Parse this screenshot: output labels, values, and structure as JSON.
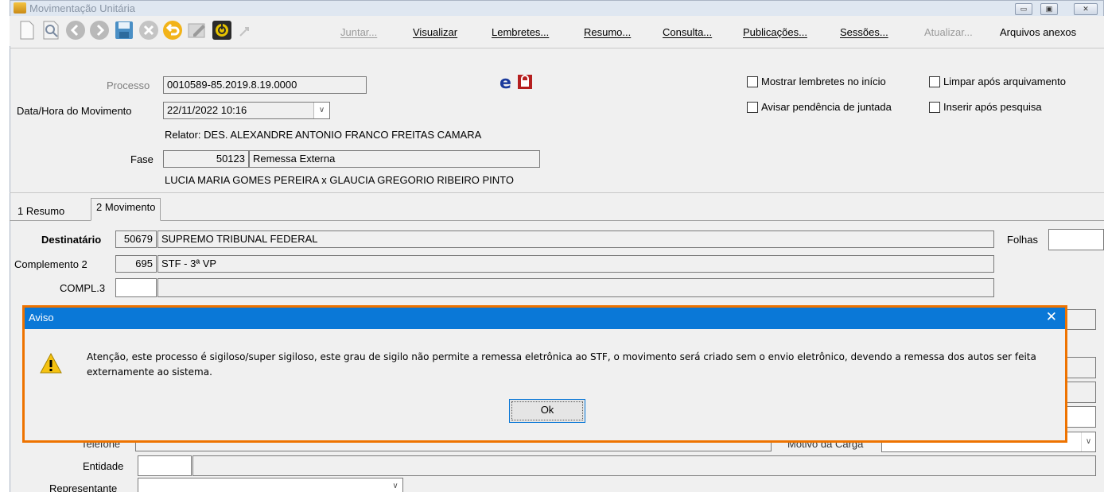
{
  "window": {
    "title": "Movimentação Unitária",
    "buttons": {
      "minimize": "▭",
      "restore": "▣",
      "close": "✕"
    }
  },
  "toolbar": {
    "icons": [
      "new-doc-icon",
      "search-doc-icon",
      "back-icon",
      "forward-icon",
      "save-icon",
      "cancel-icon",
      "undo-icon",
      "edit-icon",
      "power-icon",
      "move-icon"
    ],
    "menu": {
      "juntar": "Juntar...",
      "visualizar": "Visualizar",
      "lembretes": "Lembretes...",
      "resumo": "Resumo...",
      "consulta": "Consulta...",
      "publicacoes": "Publicações...",
      "sessoes": "Sessões...",
      "atualizar": "Atualizar...",
      "arquivos": "Arquivos anexos"
    }
  },
  "header": {
    "processo_label": "Processo",
    "processo_value": "0010589-85.2019.8.19.0000",
    "datahora_label": "Data/Hora do Movimento",
    "datahora_value": "22/11/2022 10:16",
    "relator": "Relator: DES. ALEXANDRE ANTONIO FRANCO FREITAS CAMARA",
    "fase_label": "Fase",
    "fase_code": "50123",
    "fase_value": "Remessa Externa",
    "partes": "LUCIA MARIA GOMES PEREIRA x GLAUCIA GREGORIO RIBEIRO PINTO",
    "checkboxes": {
      "mostrar": "Mostrar lembretes no início",
      "limpar": "Limpar após arquivamento",
      "avisar": "Avisar pendência de juntada",
      "inserir": "Inserir após pesquisa"
    }
  },
  "tabs": {
    "resumo": "1 Resumo",
    "movimento": "2 Movimento"
  },
  "movimento": {
    "destinatario_label": "Destinatário",
    "destinatario_code": "50679",
    "destinatario_value": "SUPREMO TRIBUNAL FEDERAL",
    "folhas_label": "Folhas",
    "complemento_label": "Complemento 2",
    "complemento_code": "695",
    "complemento_value": "STF - 3ª VP",
    "compl3_label": "COMPL.3",
    "telefone_label": "Telefone",
    "motivo_label": "Motivo da Carga",
    "entidade_label": "Entidade",
    "representante_label": "Representante"
  },
  "dialog": {
    "title": "Aviso",
    "close": "✕",
    "message": "Atenção, este processo é sigiloso/super sigiloso, este grau de sigilo não permite a remessa eletrônica ao STF, o movimento será criado sem o envio eletrônico, devendo a remessa dos autos ser feita externamente ao sistema.",
    "ok_label": "Ok"
  }
}
